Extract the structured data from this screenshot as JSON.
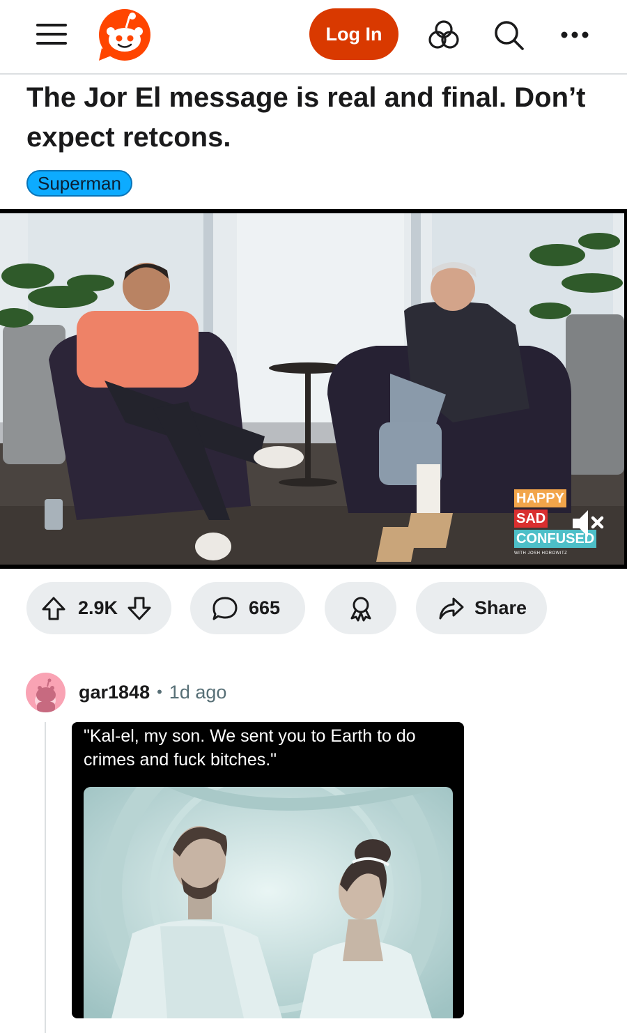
{
  "header": {
    "login_label": "Log In",
    "menu_icon": "hamburger-menu-icon",
    "logo_icon": "reddit-snoo-logo",
    "games_icon": "games-icon",
    "search_icon": "search-icon",
    "more_icon": "more-options-icon",
    "brand_color": "#d93900"
  },
  "post": {
    "title": "The Jor El message is real and final. Don’t expect retcons.",
    "flair": "Superman",
    "flair_color": "#0dabff",
    "video": {
      "overlay_logo": [
        "HAPPY",
        "SAD",
        "CONFUSED"
      ],
      "overlay_sub": "WITH JOSH HOROWITZ",
      "mute_icon": "speaker-muted-icon"
    },
    "actions": {
      "score": "2.9K",
      "comments": "665",
      "share_label": "Share",
      "upvote_icon": "upvote-arrow-icon",
      "downvote_icon": "downvote-arrow-icon",
      "comment_icon": "speech-bubble-icon",
      "award_icon": "award-ribbon-icon",
      "share_icon": "share-arrow-icon"
    }
  },
  "comment": {
    "author": "gar1848",
    "separator": "•",
    "time": "1d ago",
    "meme_caption": "\"Kal-el, my son.  We sent you to Earth to do crimes and fuck bitches.\""
  }
}
